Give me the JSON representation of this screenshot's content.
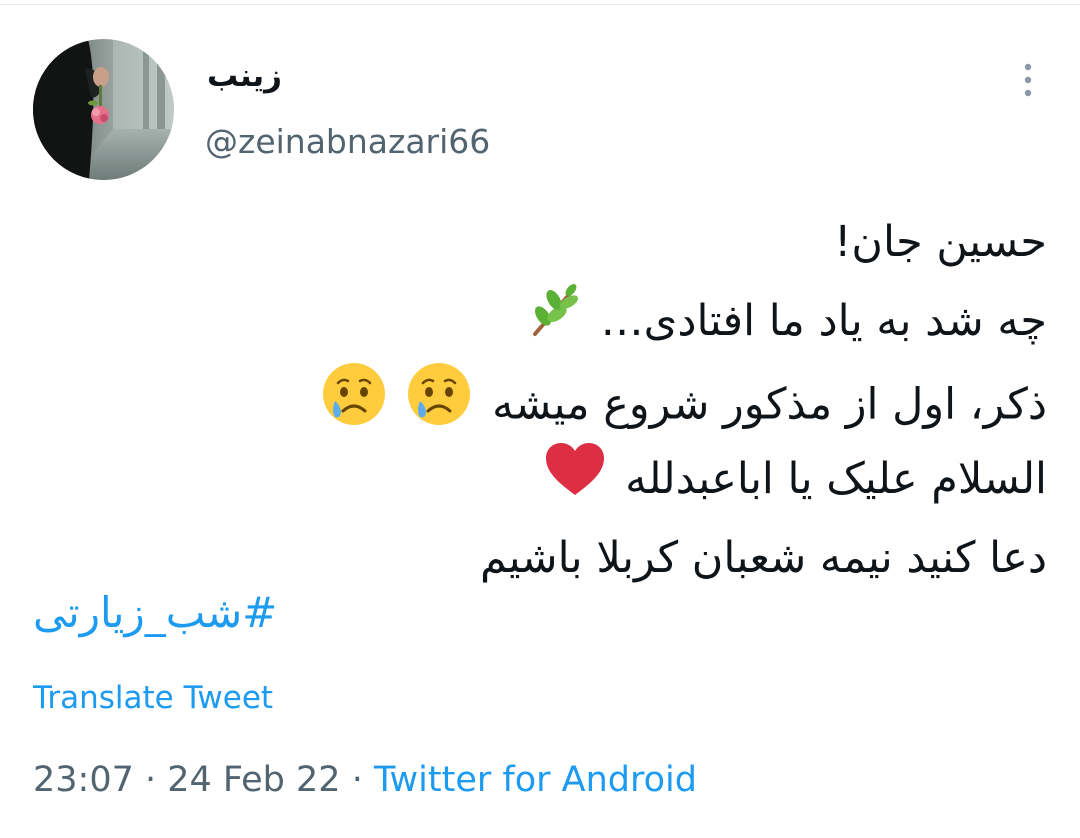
{
  "author": {
    "display_name": "زینب",
    "handle": "@zeinabnazari66",
    "avatar_icon": "avatar-photo-hand-holding-rose"
  },
  "tweet": {
    "lines": [
      {
        "text": "حسین جان!",
        "emojis": []
      },
      {
        "text": "چه شد به یاد ما افتادی…",
        "emojis": [
          "herb-branch-icon"
        ]
      },
      {
        "text": "ذکر، اول از مذکور شروع میشه",
        "emojis": [
          "crying-face-icon",
          "crying-face-icon"
        ]
      },
      {
        "text": "السلام علیک یا اباعبدلله",
        "emojis": [
          "red-heart-icon"
        ]
      },
      {
        "text": "دعا کنید نیمه شعبان کربلا باشیم",
        "emojis": []
      }
    ],
    "hashtag": "#شب_زیارتی"
  },
  "translate_label": "Translate Tweet",
  "meta": {
    "time": "23:07",
    "separator": " · ",
    "date": "24 Feb 22",
    "source": "Twitter for Android"
  },
  "colors": {
    "link": "#1d9bf0",
    "secondary_text": "#536471",
    "primary_text": "#0f1419"
  }
}
